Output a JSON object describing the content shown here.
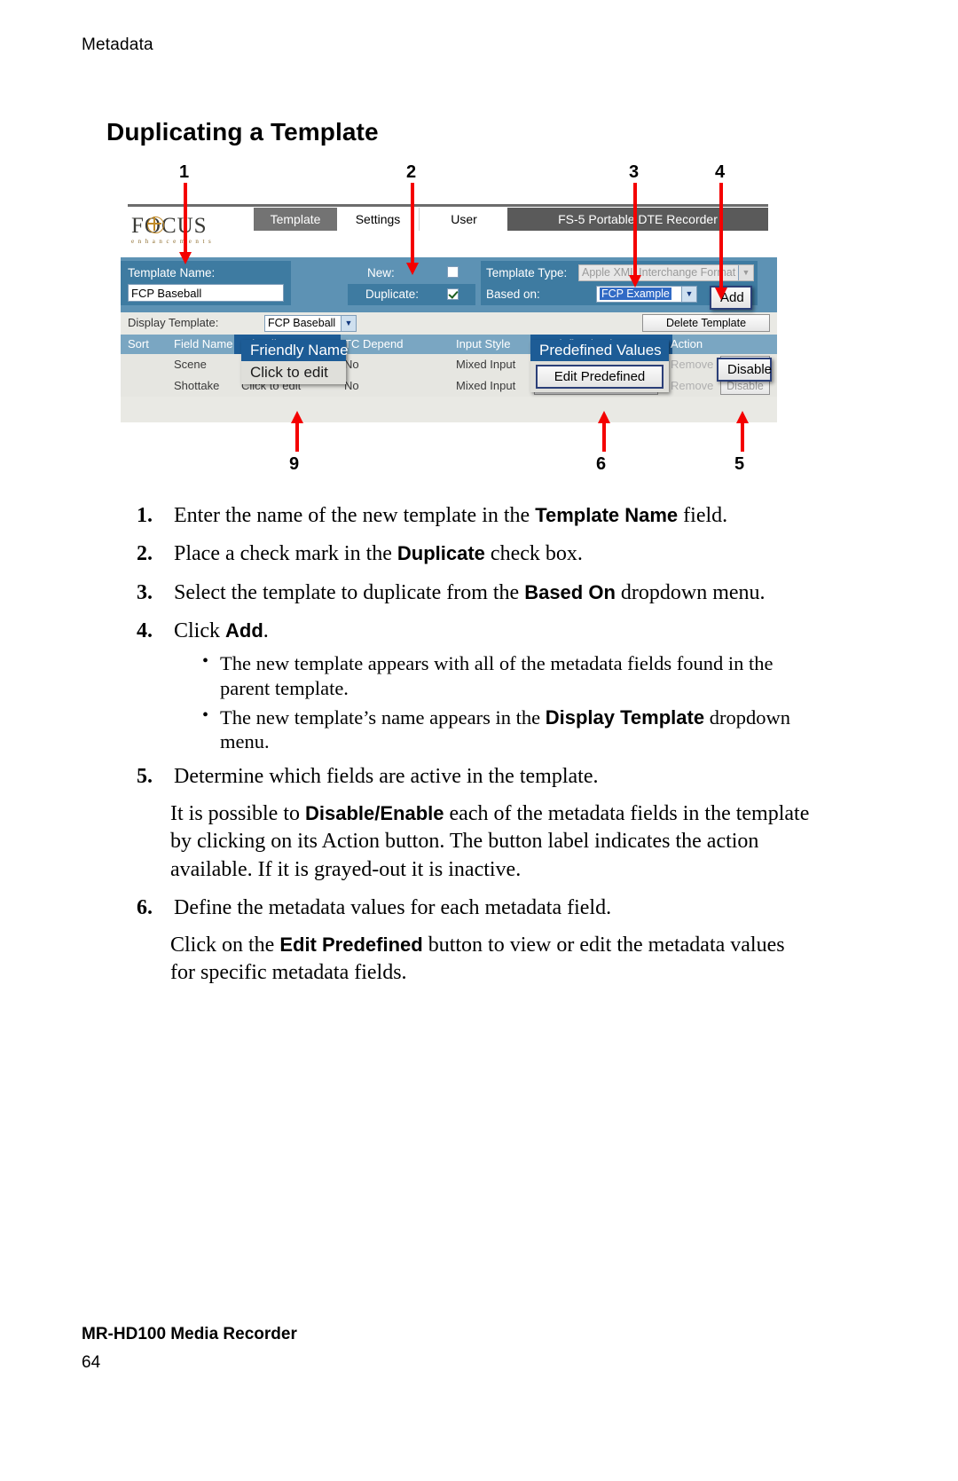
{
  "page": {
    "running_head": "Metadata",
    "section_title": "Duplicating a Template",
    "footer_title": "MR-HD100 Media Recorder",
    "footer_page": "64"
  },
  "figure": {
    "callouts_top": [
      "1",
      "2",
      "3",
      "4"
    ],
    "callouts_bottom": [
      "9",
      "6",
      "5"
    ],
    "app": {
      "logo_main": "FOCUS",
      "logo_sub": "e n h a n c e m e n t s",
      "tabs": [
        {
          "label": "Template",
          "state": "inactive"
        },
        {
          "label": "Settings",
          "state": "active"
        },
        {
          "label": "User",
          "state": "active"
        }
      ],
      "device_title": "FS-5 Portable DTE Recorder",
      "form": {
        "template_name_label": "Template Name:",
        "template_name_value": "FCP Baseball",
        "new_label": "New:",
        "new_checked": false,
        "duplicate_label": "Duplicate:",
        "duplicate_checked": true,
        "template_type_label": "Template Type:",
        "template_type_value": "Apple XML Interchange Format",
        "based_on_label": "Based on:",
        "based_on_value": "FCP Example",
        "add_button": "Add"
      },
      "display_template_label": "Display Template:",
      "display_template_value": "FCP Baseball",
      "delete_template_button": "Delete Template",
      "grid": {
        "headers": [
          "Sort",
          "Field Name",
          "Friendly Name",
          "TC Depend",
          "Input Style",
          "Predefined Values",
          "Action"
        ],
        "rows": [
          {
            "sort": "",
            "field_name": "Scene",
            "friendly_name": "Click to edit",
            "tc_depend": "No",
            "input_style": "Mixed Input",
            "predefined_button": "Edit Predefined",
            "remove_button": "Remove",
            "disable_button": "Disable"
          },
          {
            "sort": "",
            "field_name": "Shottake",
            "friendly_name": "Click to edit",
            "tc_depend": "No",
            "input_style": "Mixed Input",
            "predefined_button": "Edit Predefined",
            "remove_button": "Remove",
            "disable_button": "Disable"
          }
        ]
      },
      "magnified": {
        "friendly_name_header": "Friendly Name",
        "friendly_name_cell": "Click to edit",
        "predefined_values_header": "Predefined Values",
        "edit_predefined_button": "Edit Predefined",
        "disable_button": "Disable",
        "add_button": "Add"
      }
    }
  },
  "steps": {
    "s1": {
      "num": "1.",
      "text_a": "Enter the name of the new template in the ",
      "bold": "Template Name",
      "text_b": " field."
    },
    "s2": {
      "num": "2.",
      "text_a": "Place a check mark in the ",
      "bold": "Duplicate",
      "text_b": " check box."
    },
    "s3": {
      "num": "3.",
      "text_a": "Select the template to duplicate from the ",
      "bold": "Based On",
      "text_b": " dropdown menu."
    },
    "s4": {
      "num": "4.",
      "text_a": "Click ",
      "bold": "Add",
      "text_b": "."
    },
    "s4_bullets": [
      {
        "text_a": "The new template appears with all of the metadata fields found in the parent template.",
        "bold": "",
        "text_b": ""
      },
      {
        "text_a": "The new template’s name appears in the ",
        "bold": "Display Template",
        "text_b": " dropdown menu."
      }
    ],
    "s5": {
      "num": "5.",
      "text_a": "Determine which fields are active in the template.",
      "bold": "",
      "text_b": ""
    },
    "s5_note": {
      "text_a": "It is possible to ",
      "bold": "Disable/Enable",
      "text_b": " each of the metadata fields in the template by clicking on its Action button. The button label indicates the action available. If it is grayed-out it is inactive."
    },
    "s6": {
      "num": "6.",
      "text_a": "Define the metadata values for each metadata field.",
      "bold": "",
      "text_b": ""
    },
    "s6_note": {
      "text_a": "Click on the ",
      "bold": "Edit Predefined",
      "text_b": " button to view or edit the metadata values for specific metadata fields."
    }
  }
}
